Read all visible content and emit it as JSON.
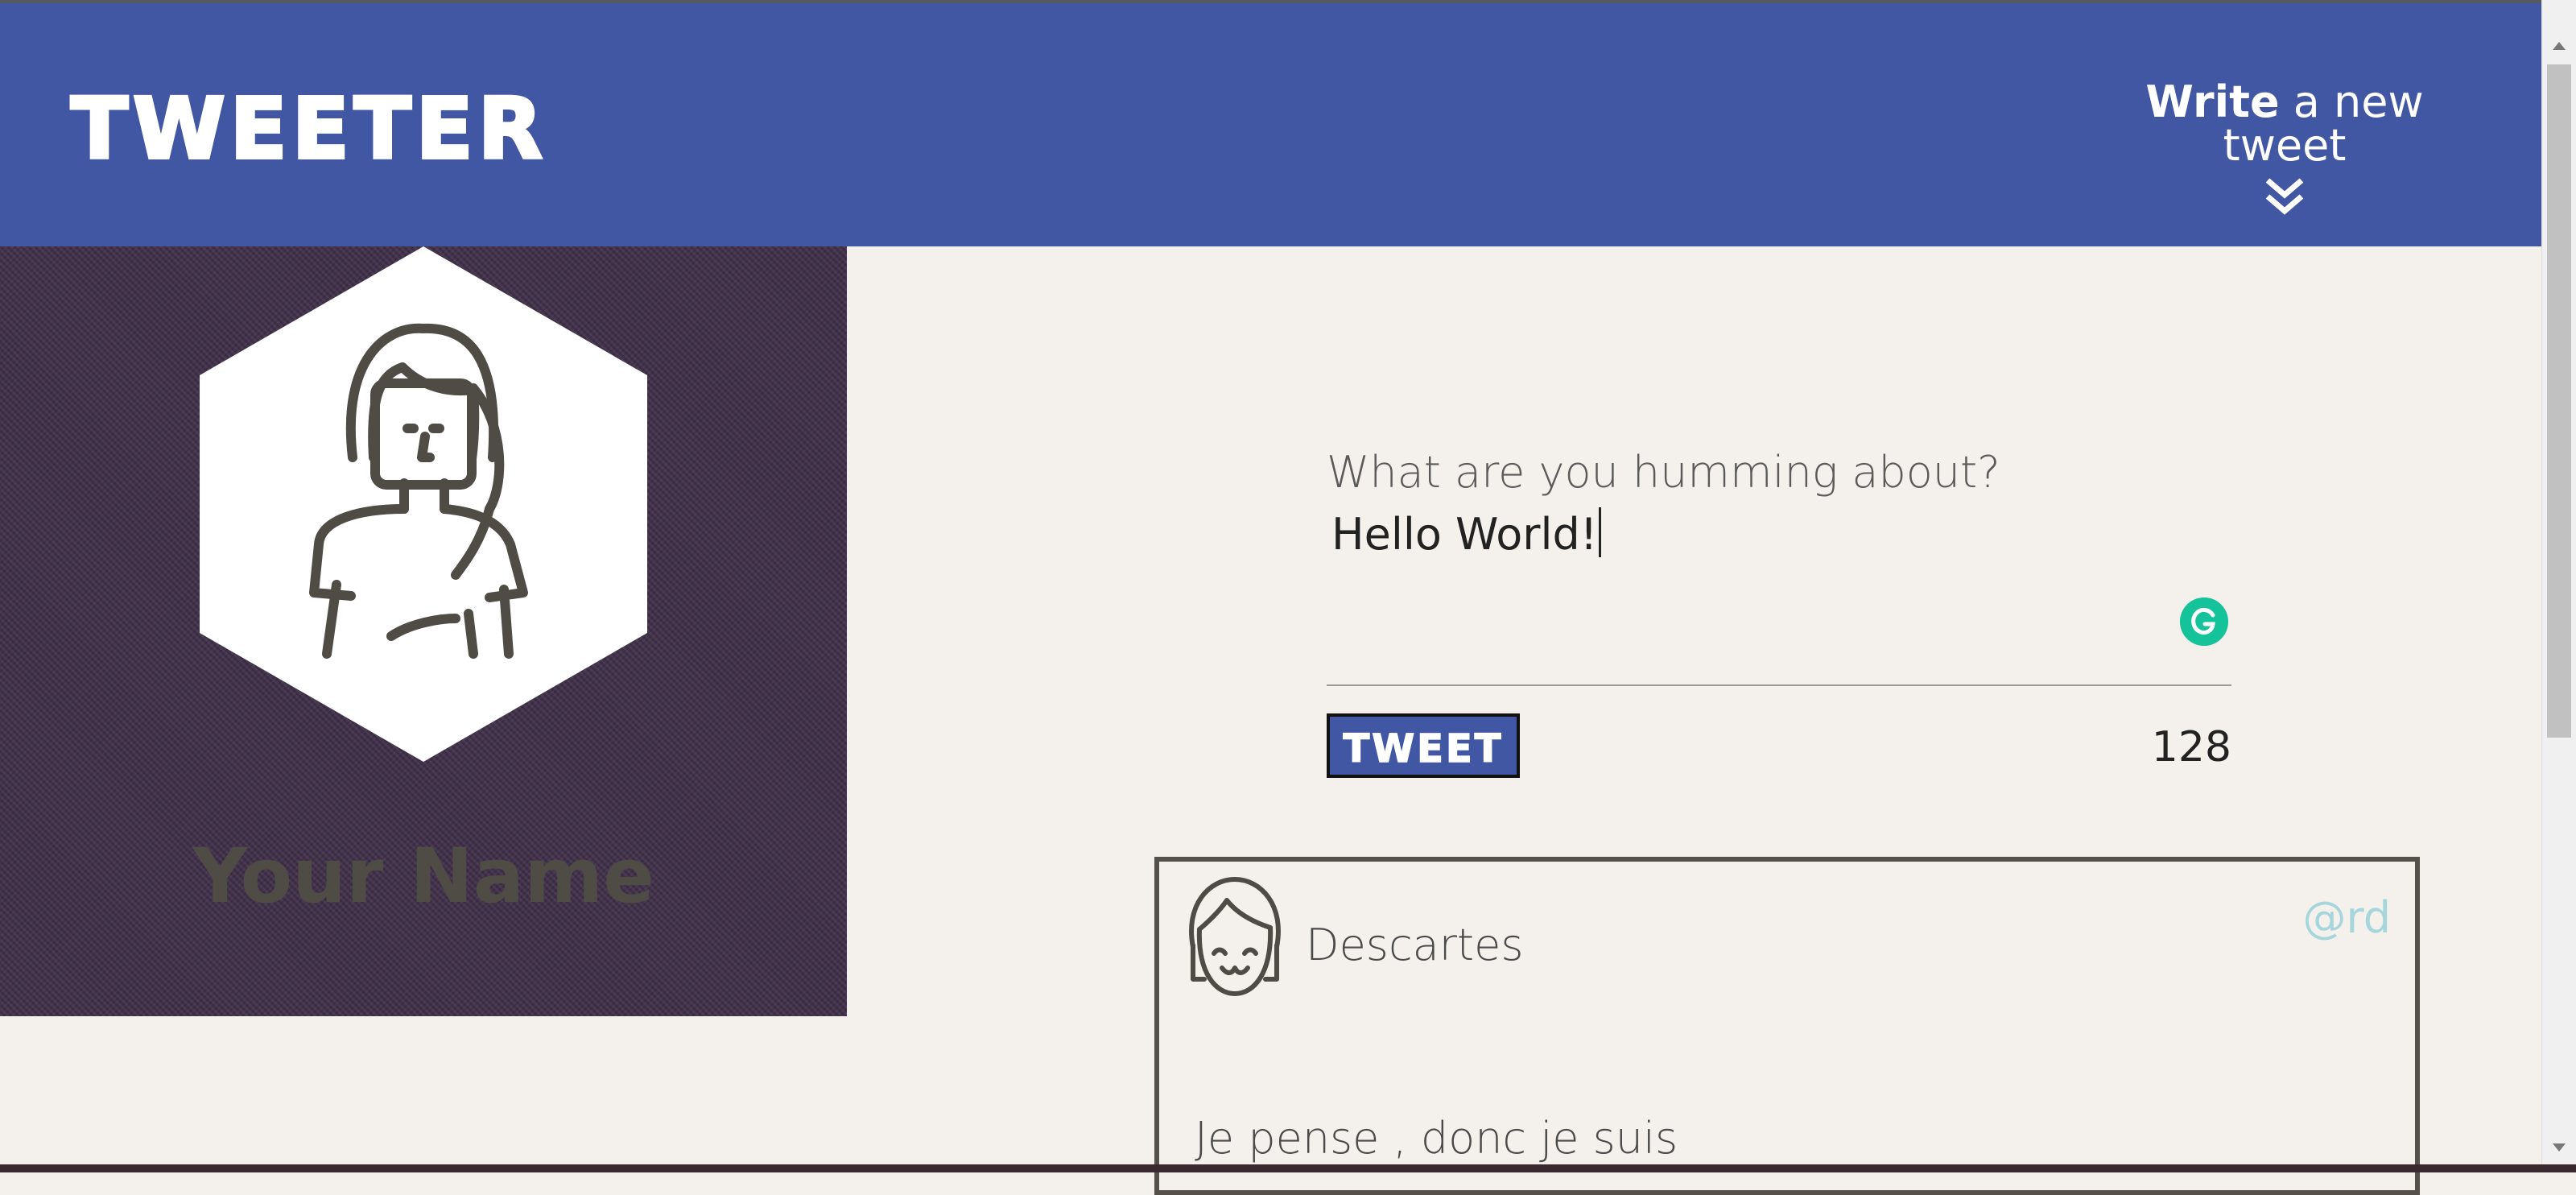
{
  "header": {
    "logo": "TWEETER",
    "compose_toggle": {
      "bold": "Write",
      "rest": " a new tweet",
      "icon": "double-chevron-down-icon"
    }
  },
  "profile": {
    "name": "Your Name",
    "avatar_icon": "woman-avatar-icon"
  },
  "composer": {
    "prompt": "What are you humming about?",
    "value": "Hello World!",
    "tweet_button": "TWEET",
    "counter": "128",
    "grammarly_icon": "grammarly-icon"
  },
  "tweets": [
    {
      "author": "Descartes",
      "handle": "@rd",
      "text": "Je pense , donc je suis",
      "avatar_icon": "girl-avatar-icon"
    }
  ],
  "colors": {
    "header": "#4157a4",
    "background": "#f4f1ed",
    "profile_bg": "#3f2f48",
    "handle": "#a6d6dc",
    "grammarly": "#15c39a"
  }
}
